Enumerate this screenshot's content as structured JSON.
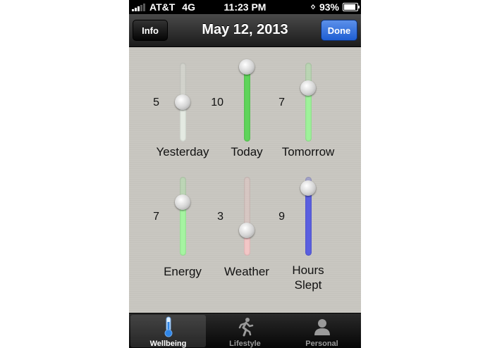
{
  "status_bar": {
    "carrier": "AT&T",
    "network": "4G",
    "time": "11:23 PM",
    "battery": "93%"
  },
  "nav": {
    "title": "May 12, 2013",
    "info_label": "Info",
    "done_label": "Done"
  },
  "sliders": [
    {
      "label": "Yesterday",
      "value": "5",
      "level": 0.5,
      "color": "#e4eae2"
    },
    {
      "label": "Today",
      "value": "10",
      "level": 1.0,
      "color": "#5fd45a"
    },
    {
      "label": "Tomorrow",
      "value": "7",
      "level": 0.7,
      "color": "#9ef29a"
    },
    {
      "label": "Energy",
      "value": "7",
      "level": 0.7,
      "color": "#a5f4a1"
    },
    {
      "label": "Weather",
      "value": "3",
      "level": 0.3,
      "color": "#f3c6c6"
    },
    {
      "label": "Hours\nSlept",
      "value": "9",
      "level": 0.9,
      "color": "#5a5fe0"
    }
  ],
  "tabs": [
    {
      "label": "Wellbeing",
      "icon": "thermometer-icon",
      "active": true
    },
    {
      "label": "Lifestyle",
      "icon": "running-figure-icon",
      "active": false
    },
    {
      "label": "Personal",
      "icon": "person-icon",
      "active": false
    }
  ]
}
